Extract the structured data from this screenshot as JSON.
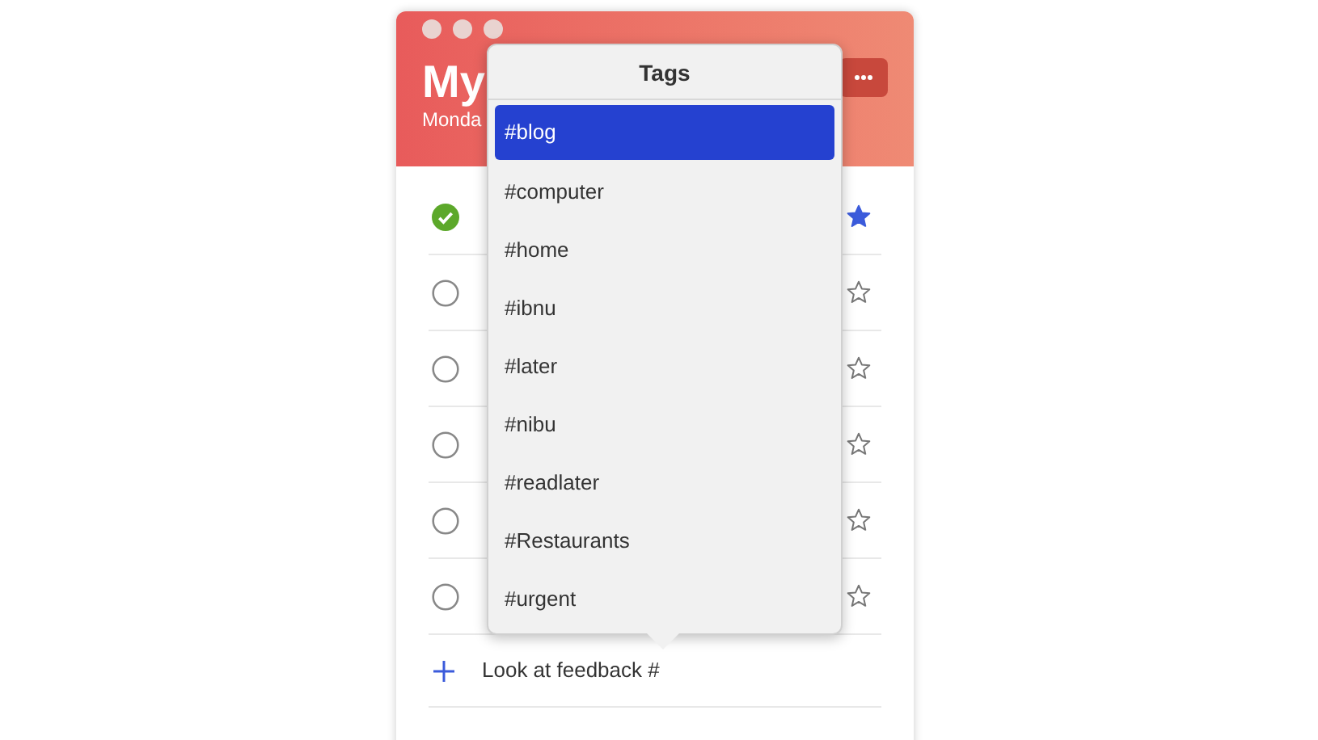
{
  "window": {
    "title": "My",
    "subtitle": "Monda"
  },
  "tasks": [
    {
      "checked": true,
      "starred": true
    },
    {
      "checked": false,
      "starred": false
    },
    {
      "checked": false,
      "starred": false
    },
    {
      "checked": false,
      "starred": false
    },
    {
      "checked": false,
      "starred": false
    },
    {
      "checked": false,
      "starred": false
    }
  ],
  "new_task": {
    "value": "Look at feedback #"
  },
  "tags_popup": {
    "title": "Tags",
    "items": [
      {
        "label": "#blog",
        "selected": true
      },
      {
        "label": "#computer",
        "selected": false
      },
      {
        "label": "#home",
        "selected": false
      },
      {
        "label": "#ibnu",
        "selected": false
      },
      {
        "label": "#later",
        "selected": false
      },
      {
        "label": "#nibu",
        "selected": false
      },
      {
        "label": "#readlater",
        "selected": false
      },
      {
        "label": "#Restaurants",
        "selected": false
      },
      {
        "label": "#urgent",
        "selected": false
      }
    ]
  }
}
